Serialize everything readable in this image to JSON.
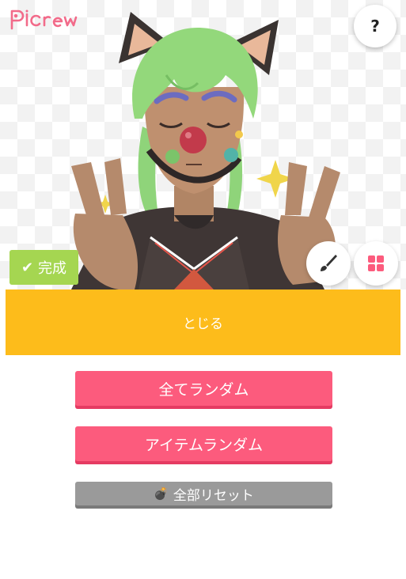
{
  "header": {
    "logo_text": "Picrew",
    "help_label": "?"
  },
  "toolbar": {
    "done_label": "完成",
    "brush_icon": "brush-icon",
    "grid_icon": "grid-icon"
  },
  "close_label": "とじる",
  "actions": {
    "random_all_label": "全てランダム",
    "random_item_label": "アイテムランダム",
    "reset_all_label": "全部リセット",
    "reset_icon": "💣"
  },
  "colors": {
    "accent_pink": "#fc5b7d",
    "close_bar": "#fdbc1b",
    "done_green": "#a5d651",
    "reset_gray": "#9a9a9a"
  }
}
